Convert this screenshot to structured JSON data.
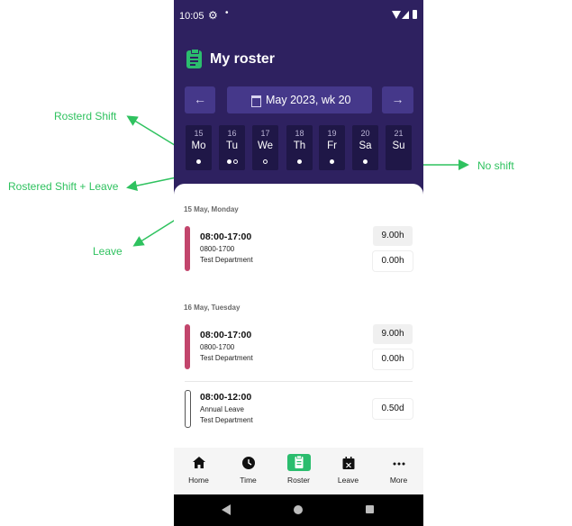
{
  "status_bar": {
    "time": "10:05"
  },
  "header": {
    "title": "My roster",
    "prev_label": "←",
    "next_label": "→",
    "week_label": "May 2023, wk 20"
  },
  "days": [
    {
      "num": "15",
      "label": "Mo"
    },
    {
      "num": "16",
      "label": "Tu"
    },
    {
      "num": "17",
      "label": "We"
    },
    {
      "num": "18",
      "label": "Th"
    },
    {
      "num": "19",
      "label": "Fr"
    },
    {
      "num": "20",
      "label": "Sa"
    },
    {
      "num": "21",
      "label": "Su"
    }
  ],
  "sections": [
    {
      "date": "15 May, Monday",
      "entries": [
        {
          "time": "08:00-17:00",
          "line2": "0800-1700",
          "dept": "Test Department",
          "hours": "9.00h",
          "extra": "0.00h"
        }
      ]
    },
    {
      "date": "16 May, Tuesday",
      "entries": [
        {
          "time": "08:00-17:00",
          "line2": "0800-1700",
          "dept": "Test Department",
          "hours": "9.00h",
          "extra": "0.00h"
        },
        {
          "time": "08:00-12:00",
          "line2": "Annual Leave",
          "dept": "Test Department",
          "hours": "0.50d"
        }
      ]
    }
  ],
  "bottom_nav": [
    "Home",
    "Time",
    "Roster",
    "Leave",
    "More"
  ],
  "annotations": {
    "rostered_shift": "Rosterd Shift",
    "rostered_leave": "Rostered Shift + Leave",
    "leave": "Leave",
    "no_shift": "No shift"
  },
  "colors": {
    "header_bg": "#2e2160",
    "accent_green": "#2bbd6e",
    "shift_bar": "#c2456c",
    "annotation": "#2fc25f"
  },
  "icons": [
    "gear-icon",
    "wifi-icon",
    "signal-icon",
    "battery-icon",
    "clipboard-icon",
    "calendar-icon",
    "home-icon",
    "clock-icon",
    "leave-calendar-icon",
    "more-icon",
    "back-icon",
    "home-circle-icon",
    "recents-icon"
  ]
}
